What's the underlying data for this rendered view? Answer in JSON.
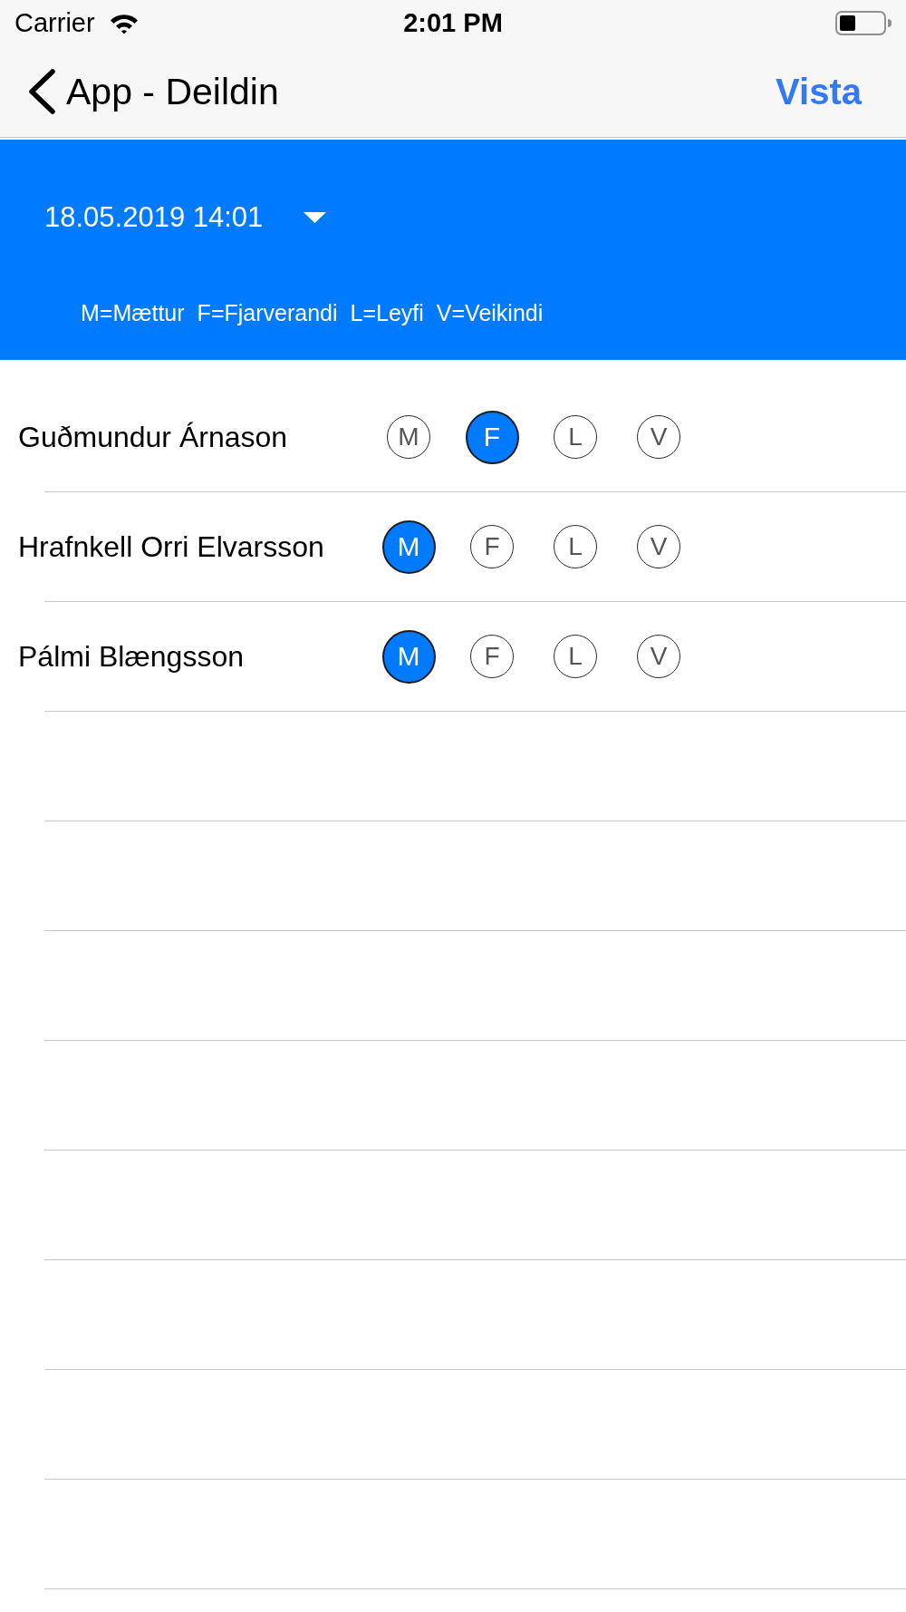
{
  "status_bar": {
    "carrier": "Carrier",
    "time": "2:01 PM"
  },
  "nav_bar": {
    "back_title": "App - Deildin",
    "action": "Vista"
  },
  "header": {
    "date": "18.05.2019 14:01",
    "legend": [
      "M=Mættur",
      "F=Fjarverandi",
      "L=Leyfi",
      "V=Veikindi"
    ]
  },
  "rows": [
    {
      "name": "Guðmundur Árnason",
      "options": [
        {
          "label": "M",
          "selected": false
        },
        {
          "label": "F",
          "selected": true
        },
        {
          "label": "L",
          "selected": false
        },
        {
          "label": "V",
          "selected": false
        }
      ]
    },
    {
      "name": "Hrafnkell Orri Elvarsson",
      "options": [
        {
          "label": "M",
          "selected": true
        },
        {
          "label": "F",
          "selected": false
        },
        {
          "label": "L",
          "selected": false
        },
        {
          "label": "V",
          "selected": false
        }
      ]
    },
    {
      "name": "Pálmi Blængsson",
      "options": [
        {
          "label": "M",
          "selected": true
        },
        {
          "label": "F",
          "selected": false
        },
        {
          "label": "L",
          "selected": false
        },
        {
          "label": "V",
          "selected": false
        }
      ]
    }
  ]
}
